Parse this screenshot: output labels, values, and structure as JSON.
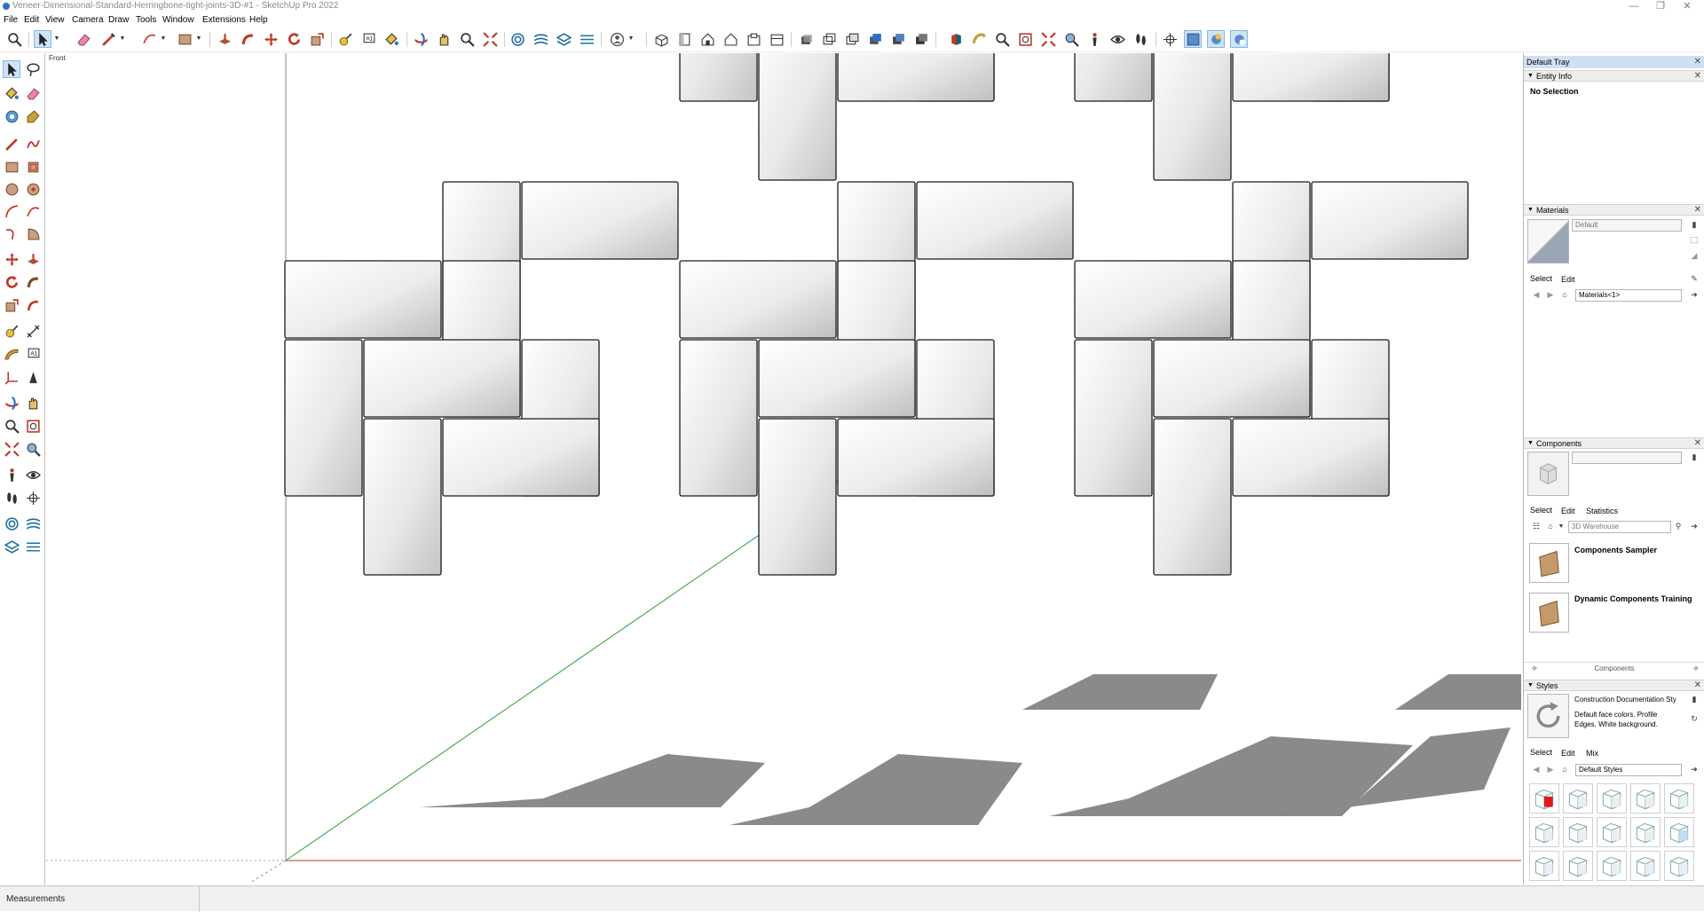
{
  "window": {
    "title": "Veneer-Dimensional-Standard-Herringbone-tight-joints-3D-#1 - SketchUp Pro 2022",
    "controls": {
      "minimize": "—",
      "restore": "❐",
      "close": "✕"
    }
  },
  "menu": [
    "File",
    "Edit",
    "View",
    "Camera",
    "Draw",
    "Tools",
    "Window",
    "Extensions",
    "Help"
  ],
  "toolbar": {
    "tools": [
      "zoom-icon",
      "select-icon",
      "eraser-icon",
      "pencil-icon",
      "arc-icon",
      "rectangle-icon",
      "pushpull-icon",
      "followme-icon",
      "move-icon",
      "rotate-icon",
      "scale-icon",
      "tape-icon",
      "text-icon",
      "paint-icon",
      "orbit-icon",
      "pan-icon",
      "zoom-icon",
      "zoom-extents-icon",
      "sandbox-icon",
      "sandbox-contours-icon",
      "stamp-icon",
      "drape-icon",
      "user-icon",
      "iso-view-icon",
      "top-view-icon",
      "front-view-icon",
      "right-view-icon",
      "back-view-icon",
      "left-view-icon",
      "xray-icon",
      "wireframe-icon",
      "hiddenline-icon",
      "shaded-icon",
      "shaded-textures-icon",
      "monochrome-icon",
      "section-plane-icon",
      "walk-icon",
      "look-around-icon",
      "zoom-window-icon",
      "position-camera-icon",
      "eye-icon",
      "footprints-icon",
      "axes-icon",
      "paste-icon",
      "view1-icon",
      "view2-icon",
      "view3-icon"
    ]
  },
  "viewport": {
    "scene_label": "Front"
  },
  "status": {
    "measurements_label": "Measurements"
  },
  "tray": {
    "title": "Default Tray",
    "entity_info": {
      "header": "Entity Info",
      "selection": "No Selection"
    },
    "materials": {
      "header": "Materials",
      "name_field": "Default",
      "tab_select": "Select",
      "tab_edit": "Edit",
      "library": "Materials<1>"
    },
    "components": {
      "header": "Components",
      "tab_select": "Select",
      "tab_edit": "Edit",
      "tab_statistics": "Statistics",
      "search_placeholder": "3D Warehouse",
      "items": [
        "Components Sampler",
        "Dynamic Components Training"
      ],
      "footer": "Components"
    },
    "styles": {
      "header": "Styles",
      "style_name": "Construction Documentation Sty",
      "style_desc": "Default face colors. Profile Edges. White background.",
      "tab_select": "Select",
      "tab_edit": "Edit",
      "tab_mix": "Mix",
      "library": "Default Styles"
    }
  },
  "colors": {
    "accent": "#cfe3f7",
    "selected_style": "#e00000",
    "axis_red": "#c0392b",
    "axis_green": "#2e9e3a",
    "shadow": "#8a8a8a"
  }
}
